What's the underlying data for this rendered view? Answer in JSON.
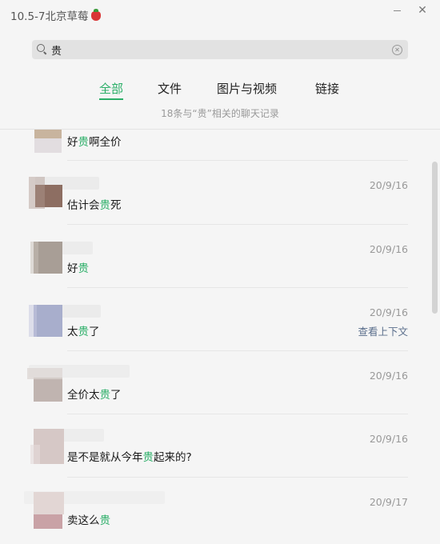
{
  "window": {
    "title": "10.5-7北京草莓",
    "title_icon": "strawberry-icon"
  },
  "search": {
    "query": "贵"
  },
  "tabs": [
    {
      "label": "全部",
      "active": true
    },
    {
      "label": "文件",
      "active": false
    },
    {
      "label": "图片与视频",
      "active": false
    },
    {
      "label": "链接",
      "active": false
    }
  ],
  "summary_text": "18条与“贵”相关的聊天记录",
  "results": [
    {
      "pre": "好",
      "hl": "贵",
      "post": "啊全价",
      "date": "",
      "avatar_colors": [
        "#c8b49e",
        "#e2dde0"
      ]
    },
    {
      "pre": "估计会",
      "hl": "贵",
      "post": "死",
      "date": "20/9/16",
      "avatar_colors": [
        "#8d6e62",
        "#b09a90"
      ]
    },
    {
      "pre": "好",
      "hl": "贵",
      "post": "",
      "date": "20/9/16",
      "avatar_colors": [
        "#a89e96",
        "#c7bfb8"
      ]
    },
    {
      "pre": "太",
      "hl": "贵",
      "post": "了",
      "date": "20/9/16",
      "link": "查看上下文",
      "avatar_colors": [
        "#a8aecc",
        "#c5c8e0"
      ]
    },
    {
      "pre": "全价太",
      "hl": "贵",
      "post": "了",
      "date": "20/9/16",
      "avatar_colors": [
        "#c0b4b0",
        "#dcd4d2"
      ]
    },
    {
      "pre": "是不是就从今年",
      "hl": "贵",
      "post": "起来的?",
      "date": "20/9/16",
      "avatar_colors": [
        "#d6c8c6",
        "#e4dbda"
      ]
    },
    {
      "pre": "卖这么",
      "hl": "贵",
      "post": "",
      "date": "20/9/17",
      "avatar_colors": [
        "#e2d6d4",
        "#c9a2a6"
      ]
    }
  ],
  "colors": {
    "accent": "#2aae67",
    "link": "#5a6e8c",
    "muted": "#999999"
  }
}
